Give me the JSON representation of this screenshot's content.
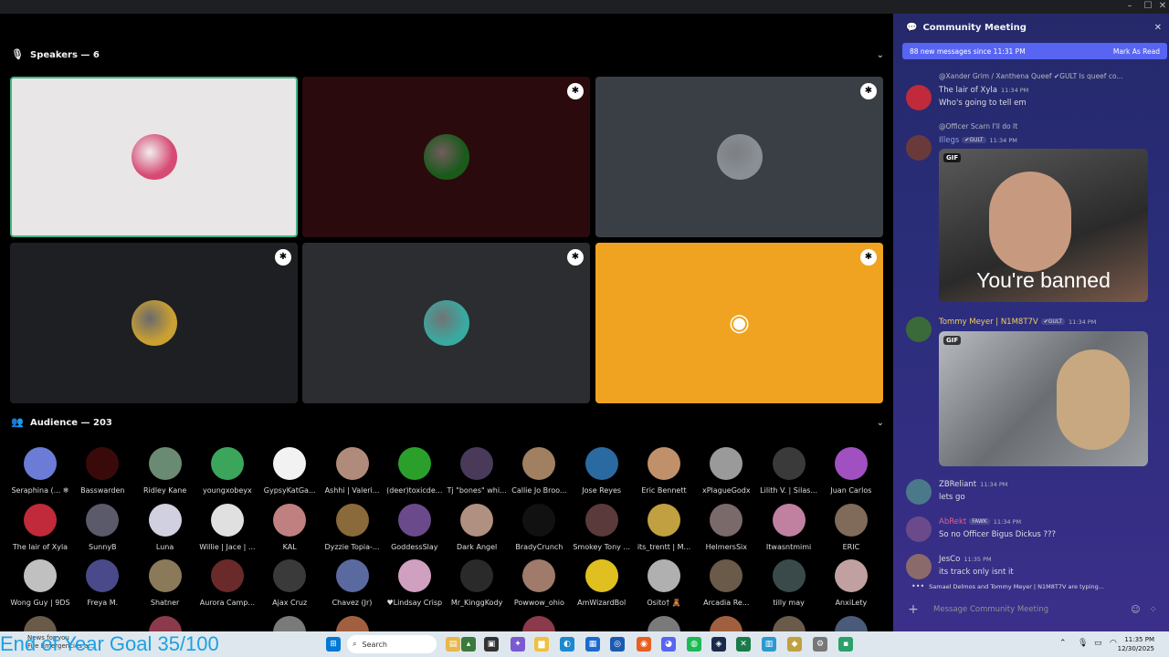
{
  "window": {
    "minimize": "–",
    "maximize": "☐",
    "close": "✕"
  },
  "stage": {
    "speakers_label": "Speakers — 6",
    "audience_label": "Audience — 203",
    "speaker_tiles": [
      {
        "bg": "#e8e6e6",
        "avatar": "#d64a73",
        "border": "#43b581",
        "badge": false
      },
      {
        "bg": "#2a0a0d",
        "avatar": "#1a5a1a",
        "badge": true
      },
      {
        "bg": "#3a3f45",
        "avatar": "#8a8f96",
        "badge": true
      },
      {
        "bg": "#1e1f22",
        "avatar": "#caa032",
        "badge": true
      },
      {
        "bg": "#2b2d31",
        "avatar": "#3aa9a0",
        "badge": true
      },
      {
        "bg": "#f0a320",
        "avatar": "discord-logo",
        "badge": true
      }
    ],
    "audience": [
      {
        "name": "Seraphina (... ❄",
        "color": "#6b7bd6"
      },
      {
        "name": "Basswarden",
        "color": "#3a0a0a"
      },
      {
        "name": "Ridley Kane",
        "color": "#6b8a74"
      },
      {
        "name": "youngxobeyx",
        "color": "#3ba55c"
      },
      {
        "name": "GypsyKatGa...",
        "color": "#f2f2f2"
      },
      {
        "name": "Ashhi | Valeri...",
        "color": "#b08a7a"
      },
      {
        "name": "(deer)toxicde...",
        "color": "#2aa02a"
      },
      {
        "name": "Tj \"bones\" whi...",
        "color": "#4a3a5a"
      },
      {
        "name": "Callie Jo Broo...",
        "color": "#a08060"
      },
      {
        "name": "Jose Reyes",
        "color": "#2a6aa0"
      },
      {
        "name": "Eric Bennett",
        "color": "#c0906a"
      },
      {
        "name": "xPlagueGodx",
        "color": "#9a9a9a"
      },
      {
        "name": "Lilith V. | Silas...",
        "color": "#3a3a3a"
      },
      {
        "name": "Juan Carlos",
        "color": "#a050c0"
      },
      {
        "name": "The lair of Xyla",
        "color": "#c02a3a"
      },
      {
        "name": "SunnyB",
        "color": "#5a5a6a"
      },
      {
        "name": "Luna",
        "color": "#d0d0e0"
      },
      {
        "name": "Willie | Jace | ...",
        "color": "#e0e0e0"
      },
      {
        "name": "KAL",
        "color": "#c08080"
      },
      {
        "name": "Dyzzie Topia-...",
        "color": "#8a6a3a"
      },
      {
        "name": "GoddessSlay",
        "color": "#6a4a8a"
      },
      {
        "name": "Dark Angel",
        "color": "#b09080"
      },
      {
        "name": "BradyCrunch",
        "color": "#111111"
      },
      {
        "name": "Smokey Tony ...",
        "color": "#5a3a3a"
      },
      {
        "name": "its_trentt | M...",
        "color": "#c0a040"
      },
      {
        "name": "HelmersSix",
        "color": "#7a6a6a"
      },
      {
        "name": "Itwasntmimi",
        "color": "#c080a0"
      },
      {
        "name": "ERIC",
        "color": "#806a5a"
      },
      {
        "name": "Wong Guy | 9DS",
        "color": "#c0c0c0"
      },
      {
        "name": "Freya M.",
        "color": "#4a4a8a"
      },
      {
        "name": "Shatner",
        "color": "#8a7a5a"
      },
      {
        "name": "Aurora Camp...",
        "color": "#6a2a2a"
      },
      {
        "name": "Ajax Cruz",
        "color": "#3a3a3a"
      },
      {
        "name": "Chavez (Jr)",
        "color": "#5a6aa0"
      },
      {
        "name": "♥Lindsay Crisp",
        "color": "#d0a0c0"
      },
      {
        "name": "Mr_KinggKody",
        "color": "#2a2a2a"
      },
      {
        "name": "Powwow_ohio",
        "color": "#a07a6a"
      },
      {
        "name": "AmWizardBol",
        "color": "#e0c020"
      },
      {
        "name": "Osito† 🧸",
        "color": "#b0b0b0"
      },
      {
        "name": "Arcadia Re...",
        "color": "#6a5a4a"
      },
      {
        "name": "tilly may",
        "color": "#3a4a4a"
      },
      {
        "name": "AnxiLety",
        "color": "#c0a0a0"
      }
    ]
  },
  "chat": {
    "title": "Community Meeting",
    "new_messages": "88 new messages since 11:31 PM",
    "mark_as_read": "Mark As Read",
    "messages": [
      {
        "reply": "@Xander Grim / Xanthena Queef ✔GULT Is queef co...",
        "author": "The lair of Xyla",
        "author_color": "#dbdee1",
        "time": "11:34 PM",
        "text": "Who's going to tell em"
      },
      {
        "reply": "@Officer Scarn I'll do It",
        "author": "Illegs",
        "author_color": "#8ea1e1",
        "tag": "✔GULT",
        "time": "11:34 PM",
        "text": ""
      },
      {
        "author": "Tommy Meyer | N1M8T7V",
        "author_color": "#f0d060",
        "tag": "✔GULT",
        "time": "11:34 PM",
        "text": ""
      },
      {
        "author": "ZBReliant",
        "author_color": "#dbdee1",
        "time": "11:34 PM",
        "text": "lets go"
      },
      {
        "author": "AbRekt",
        "author_color": "#e06090",
        "tag": "FAWK",
        "time": "11:34 PM",
        "text": "So no Officer Bigus Dickus ???"
      },
      {
        "author": "JesCo",
        "author_color": "#dbdee1",
        "time": "11:35 PM",
        "text": "its track only isnt it"
      }
    ],
    "gif_label": "GIF",
    "gif_caption": "You're banned",
    "typing": "Samael Delmos and Tommy Meyer | N1M8T7V are typing...",
    "composer_placeholder": "Message Community Meeting"
  },
  "taskbar": {
    "goal_text": "End of Year Goal 35/100",
    "news_title": "News for you",
    "news_sub": "Fire Emergencies a...",
    "search_placeholder": "Search",
    "time": "11:35 PM",
    "date": "12/30/2025"
  }
}
